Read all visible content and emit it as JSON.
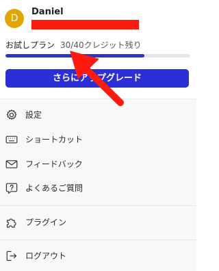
{
  "user": {
    "avatar_initial": "D",
    "name": "Daniel",
    "avatar_color": "#e2a500"
  },
  "plan": {
    "label": "お試しプラン",
    "credits_text": "30/40クレジット残り",
    "progress_fraction": 0.75
  },
  "upgrade_button": {
    "label": "さらにアップグレード",
    "color": "#2c2fd6"
  },
  "menu": {
    "items": [
      {
        "label": "設定",
        "icon": "gear-icon"
      },
      {
        "label": "ショートカット",
        "icon": "keyboard-icon"
      },
      {
        "label": "フィードバック",
        "icon": "mail-icon"
      },
      {
        "label": "よくあるご質問",
        "icon": "help-bubble-icon"
      },
      {
        "label": "プラグイン",
        "icon": "puzzle-icon"
      },
      {
        "label": "ログアウト",
        "icon": "logout-icon"
      }
    ]
  },
  "colors": {
    "annotation_red": "#ff1a10",
    "progress_fill": "#2b35c8"
  }
}
